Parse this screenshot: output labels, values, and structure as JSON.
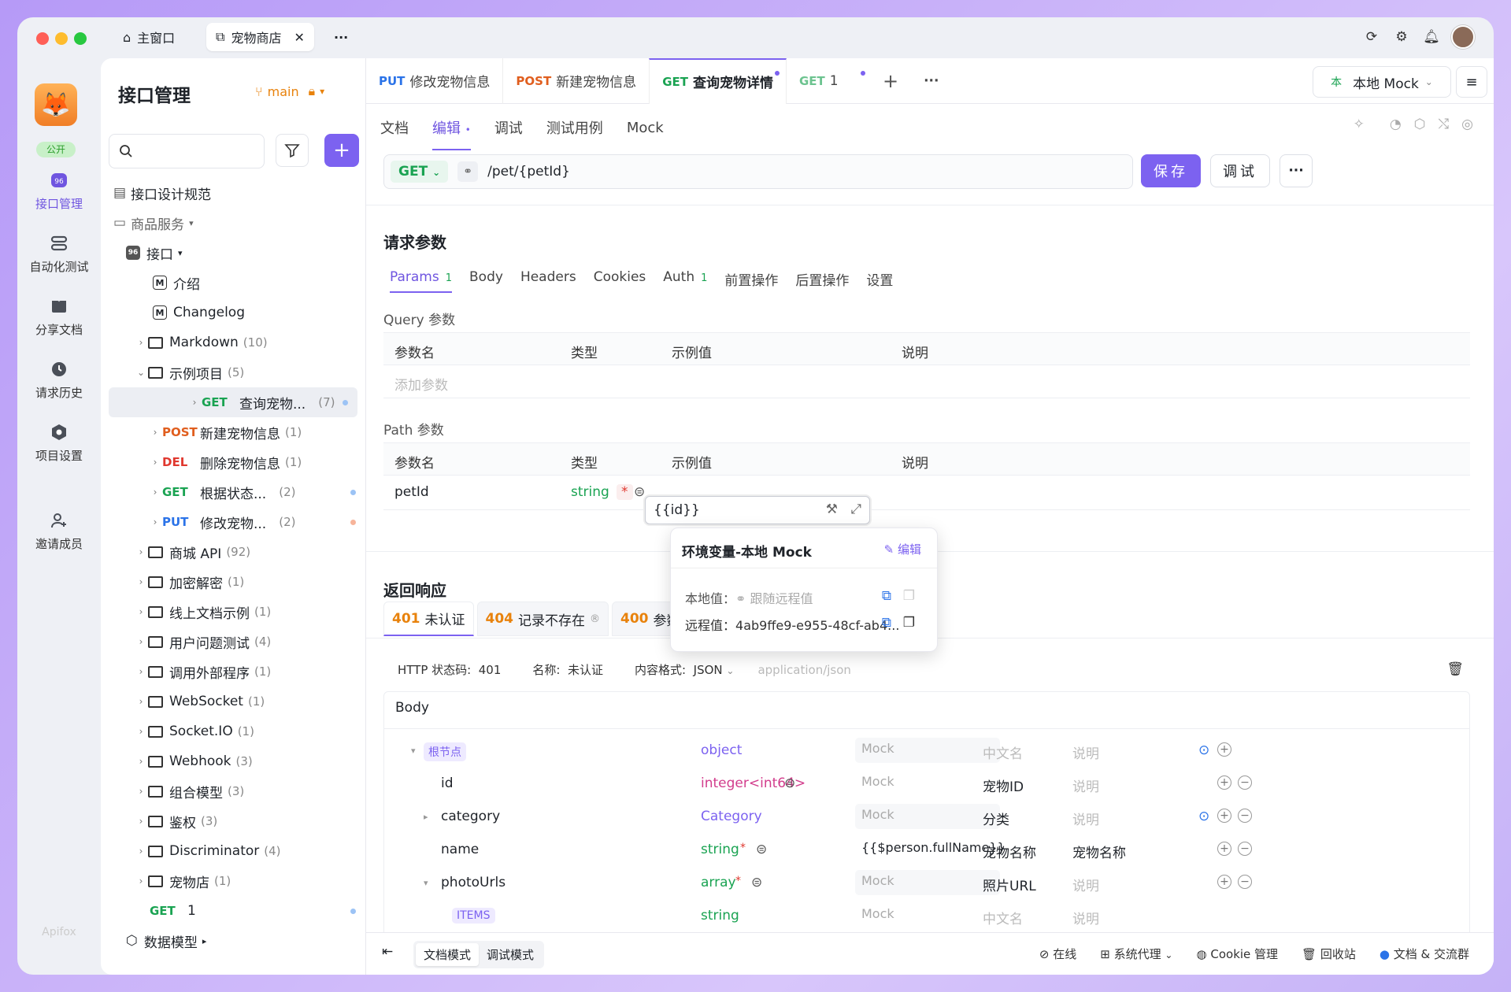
{
  "titlebar": {
    "home_tab": "主窗口",
    "project_tab": "宠物商店",
    "more": "···"
  },
  "leftnav": {
    "public_badge": "公开",
    "items": [
      {
        "label": "接口管理",
        "icon": "api-icon"
      },
      {
        "label": "自动化测试",
        "icon": "automation-icon"
      },
      {
        "label": "分享文档",
        "icon": "book-icon"
      },
      {
        "label": "请求历史",
        "icon": "clock-icon"
      },
      {
        "label": "项目设置",
        "icon": "settings-icon"
      },
      {
        "label": "邀请成员",
        "icon": "add-user-icon"
      }
    ],
    "brand": "Apifox"
  },
  "panel": {
    "title": "接口管理",
    "branch": "main",
    "tree": [
      {
        "label": "接口设计规范"
      },
      {
        "label": "商品服务"
      },
      {
        "label": "接口"
      },
      {
        "label": "介绍"
      },
      {
        "label": "Changelog"
      },
      {
        "label": "Markdown",
        "count": "(10)"
      },
      {
        "label": "示例项目",
        "count": "(5)"
      },
      {
        "method": "GET",
        "label": "查询宠物...",
        "count": "(7)"
      },
      {
        "method": "POST",
        "label": "新建宠物信息",
        "count": "(1)"
      },
      {
        "method": "DEL",
        "label": "删除宠物信息",
        "count": "(1)"
      },
      {
        "method": "GET",
        "label": "根据状态...",
        "count": "(2)"
      },
      {
        "method": "PUT",
        "label": "修改宠物...",
        "count": "(2)"
      },
      {
        "label": "商城 API",
        "count": "(92)"
      },
      {
        "label": "加密解密",
        "count": "(1)"
      },
      {
        "label": "线上文档示例",
        "count": "(1)"
      },
      {
        "label": "用户问题测试",
        "count": "(4)"
      },
      {
        "label": "调用外部程序",
        "count": "(1)"
      },
      {
        "label": "WebSocket",
        "count": "(1)"
      },
      {
        "label": "Socket.IO",
        "count": "(1)"
      },
      {
        "label": "Webhook",
        "count": "(3)"
      },
      {
        "label": "组合模型",
        "count": "(3)"
      },
      {
        "label": "鉴权",
        "count": "(3)"
      },
      {
        "label": "Discriminator",
        "count": "(4)"
      },
      {
        "label": "宠物店",
        "count": "(1)"
      },
      {
        "method": "GET",
        "label": "1"
      },
      {
        "label": "数据模型"
      }
    ]
  },
  "tabs": [
    {
      "method": "PUT",
      "label": "修改宠物信息"
    },
    {
      "method": "POST",
      "label": "新建宠物信息"
    },
    {
      "method": "GET",
      "label": "查询宠物详情"
    },
    {
      "method": "GET",
      "label": "1"
    }
  ],
  "env": {
    "label": "本地 Mock",
    "badge": "本"
  },
  "subtabs": [
    "文档",
    "编辑",
    "调试",
    "测试用例",
    "Mock"
  ],
  "request": {
    "method": "GET",
    "path": "/pet/{petId}",
    "save": "保存",
    "debug": "调试"
  },
  "params": {
    "title": "请求参数",
    "tabs": [
      {
        "label": "Params",
        "count": "1"
      },
      {
        "label": "Body"
      },
      {
        "label": "Headers"
      },
      {
        "label": "Cookies"
      },
      {
        "label": "Auth",
        "count": "1"
      },
      {
        "label": "前置操作"
      },
      {
        "label": "后置操作"
      },
      {
        "label": "设置"
      }
    ],
    "query_label": "Query 参数",
    "path_label": "Path 参数",
    "cols": [
      "参数名",
      "类型",
      "示例值",
      "说明"
    ],
    "add_placeholder": "添加参数",
    "path_row": {
      "name": "petId",
      "type": "string",
      "required": "*",
      "value": "{{id}}"
    }
  },
  "popup": {
    "title": "环境变量-本地 Mock",
    "edit": "编辑",
    "local_label": "本地值：",
    "local_value": "跟随远程值",
    "remote_label": "远程值：",
    "remote_value": "4ab9ffe9-e955-48cf-ab4..."
  },
  "response": {
    "title": "返回响应",
    "tabs": [
      {
        "code": "401",
        "label": "未认证"
      },
      {
        "code": "404",
        "label": "记录不存在"
      },
      {
        "code": "400",
        "label": "参数不正确"
      }
    ],
    "status_label": "HTTP 状态码:",
    "status": "401",
    "name_label": "名称:",
    "name": "未认证",
    "format_label": "内容格式:",
    "format": "JSON",
    "content_type": "application/json",
    "body_label": "Body",
    "rows": [
      {
        "name": "根节点",
        "type": "object",
        "mock": "Mock",
        "cn": "中文名",
        "desc": "说明"
      },
      {
        "name": "id",
        "type": "integer<int64>",
        "mock": "Mock",
        "cn": "宠物ID",
        "desc": "说明"
      },
      {
        "name": "category",
        "type": "Category",
        "mock": "Mock",
        "cn": "分类",
        "desc": "说明"
      },
      {
        "name": "name",
        "type": "string",
        "mock": "{{$person.fullName}}",
        "cn": "宠物名称",
        "desc": "宠物名称"
      },
      {
        "name": "photoUrls",
        "type": "array",
        "mock": "Mock",
        "cn": "照片URL",
        "desc": "说明"
      },
      {
        "name": "ITEMS",
        "type": "string",
        "mock": "Mock",
        "cn": "中文名",
        "desc": "说明"
      }
    ]
  },
  "footer": {
    "modes": [
      "文档模式",
      "调试模式"
    ],
    "items": [
      "在线",
      "系统代理",
      "Cookie 管理",
      "回收站",
      "文档 & 交流群"
    ]
  }
}
